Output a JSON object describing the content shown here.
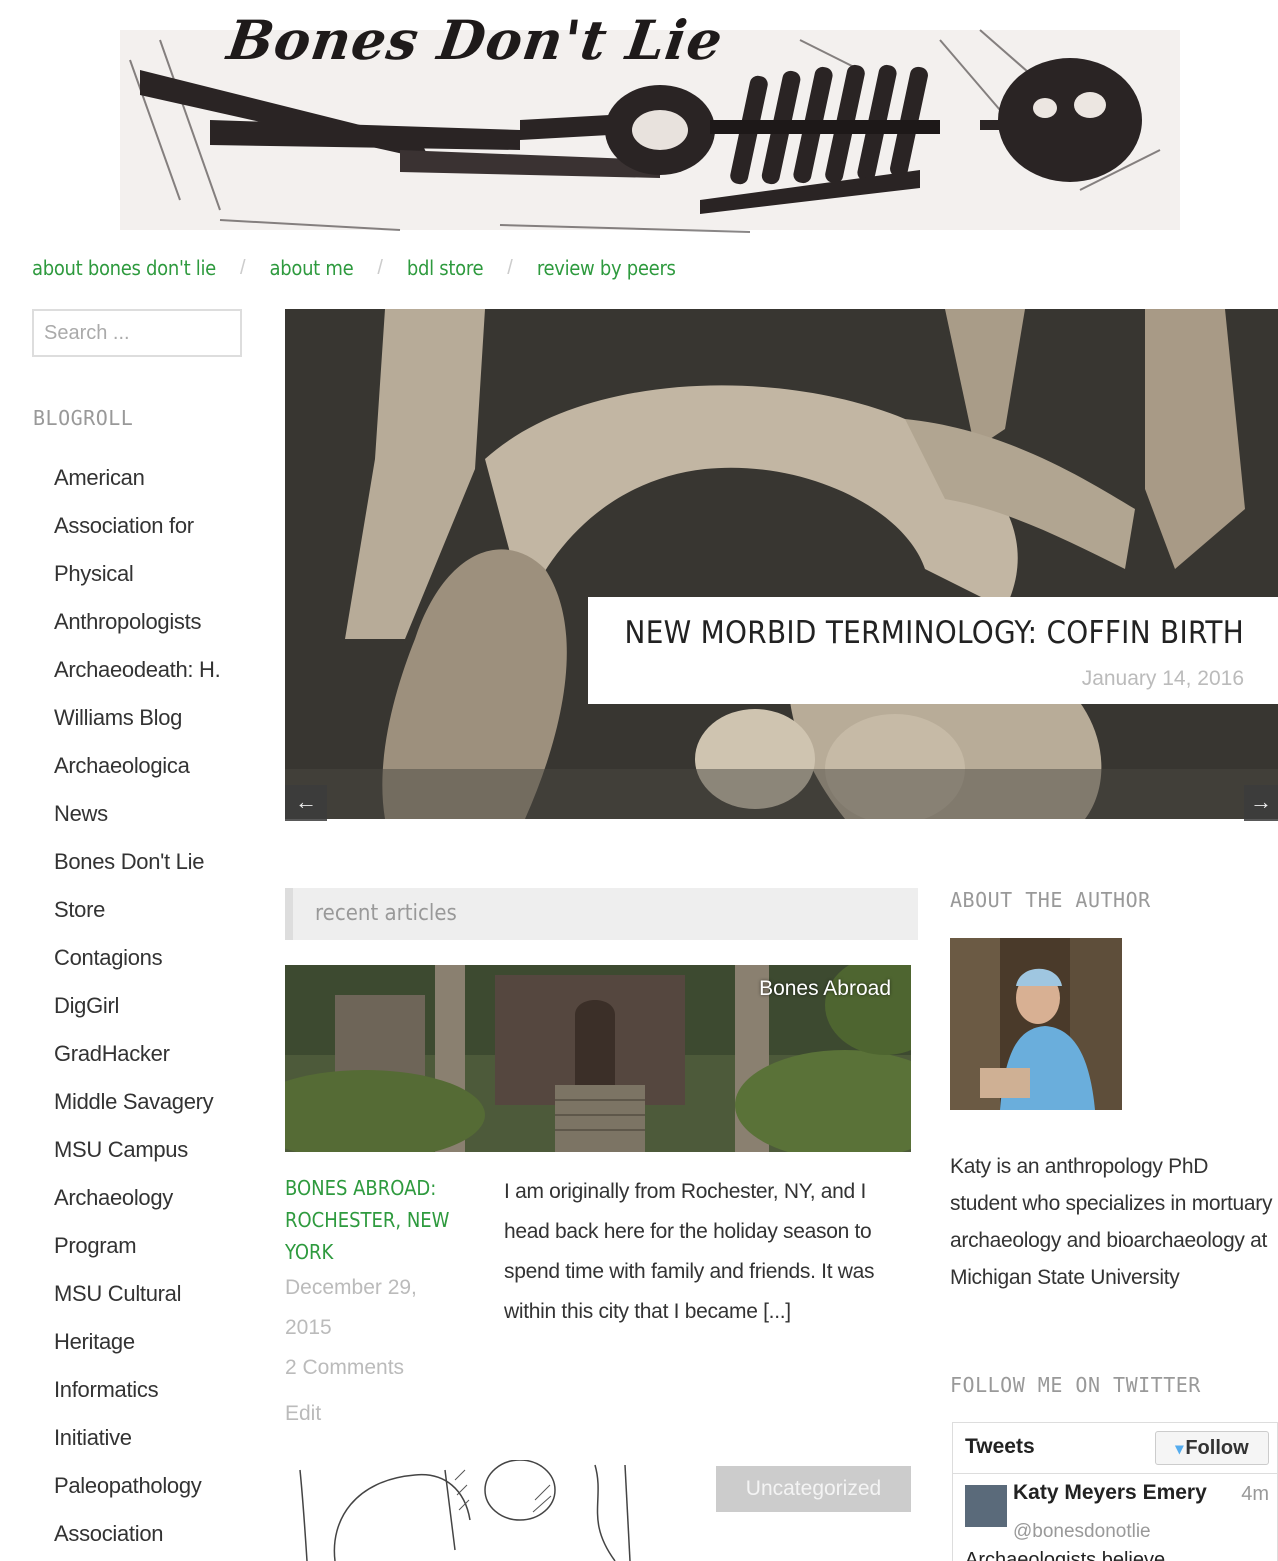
{
  "site": {
    "title": "Bones Don't Lie"
  },
  "nav": [
    "about bones don't lie",
    "about me",
    "bdl store",
    "review by peers"
  ],
  "search": {
    "placeholder": "Search ..."
  },
  "blogroll": {
    "title": "BLOGROLL",
    "lines": [
      "American",
      "Association for",
      "Physical",
      "Anthropologists",
      "Archaeodeath: H.",
      "Williams Blog",
      "Archaeologica",
      "News",
      "Bones Don't Lie",
      "Store",
      "Contagions",
      "DigGirl",
      "GradHacker",
      "Middle Savagery",
      "MSU Campus",
      "Archaeology",
      "Program",
      "MSU Cultural",
      "Heritage",
      "Informatics",
      "Initiative",
      "Paleopathology",
      "Association"
    ]
  },
  "slider": {
    "title": "NEW MORBID TERMINOLOGY: COFFIN BIRTH",
    "date": "January 14, 2016",
    "prev": "←",
    "next": "→"
  },
  "recent": {
    "heading": "recent articles",
    "post": {
      "category": "Bones Abroad",
      "title": "BONES ABROAD: ROCHESTER, NEW YORK",
      "date_line1": "December 29,",
      "date_line2": "2015",
      "comments": "2 Comments",
      "edit": "Edit",
      "excerpt": "I am originally from Rochester, NY, and I head back here for the holiday season to spend time with family and friends. It was within this city that I became [...]"
    },
    "next_category": "Uncategorized"
  },
  "author": {
    "title": "ABOUT THE AUTHOR",
    "bio": "Katy is an anthropology PhD student who specializes in mortuary archaeology and bioarchaeology at Michigan State University"
  },
  "twitter": {
    "title": "FOLLOW ME ON TWITTER",
    "tweets_label": "Tweets",
    "follow_label": "Follow",
    "name": "Katy Meyers Emery",
    "time": "4m",
    "handle": "@bonesdonotlie",
    "text": "Archaeologists believe"
  },
  "colors": {
    "link_green": "#2e9a3e",
    "muted": "#999999"
  }
}
